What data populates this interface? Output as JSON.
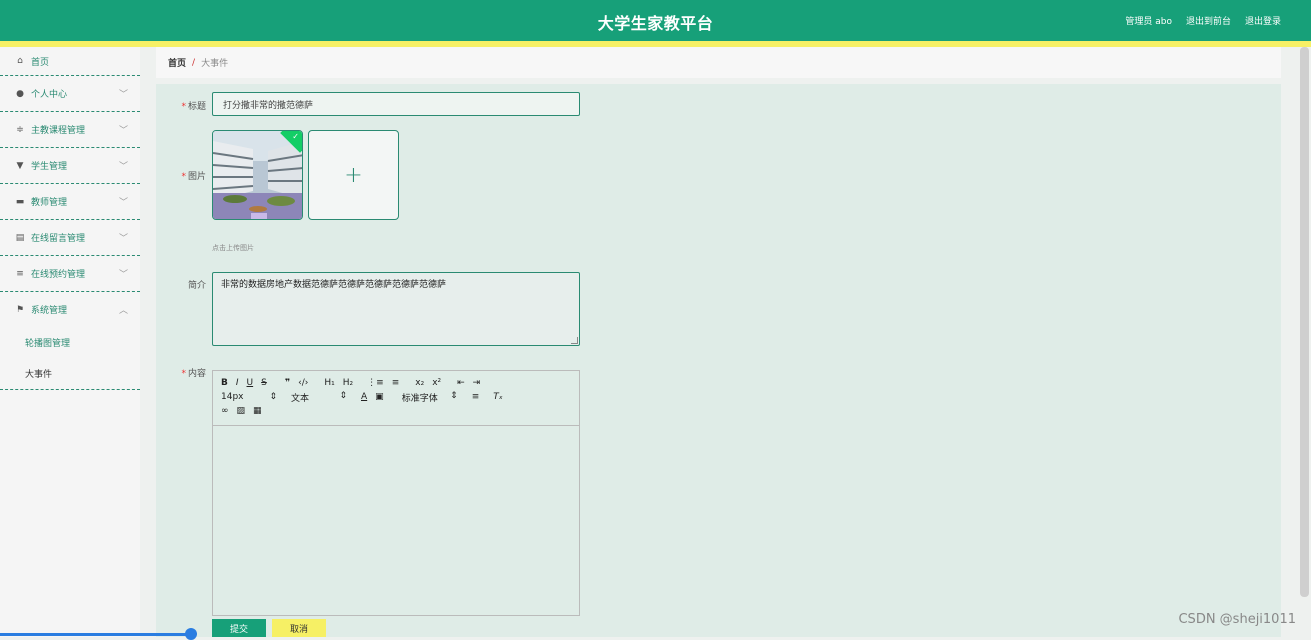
{
  "header": {
    "title": "大学生家教平台",
    "admin": "管理员 abo",
    "to_front": "退出到前台",
    "logout": "退出登录"
  },
  "sidebar": {
    "items": [
      {
        "label": "首页",
        "icon": "home-icon",
        "glyph": "⌂"
      },
      {
        "label": "个人中心",
        "icon": "user-icon",
        "glyph": "●"
      },
      {
        "label": "主教课程管理",
        "icon": "sliders-icon",
        "glyph": "≑"
      },
      {
        "label": "学生管理",
        "icon": "student-icon",
        "glyph": "▼"
      },
      {
        "label": "教师管理",
        "icon": "teacher-icon",
        "glyph": "▬"
      },
      {
        "label": "在线留言管理",
        "icon": "clipboard-icon",
        "glyph": "▤"
      },
      {
        "label": "在线预约管理",
        "icon": "list-icon",
        "glyph": "≡"
      },
      {
        "label": "系统管理",
        "icon": "flag-icon",
        "glyph": "⚑"
      }
    ],
    "sub_items": [
      {
        "label": "轮播图管理"
      },
      {
        "label": "大事件"
      }
    ]
  },
  "breadcrumb": {
    "home": "首页",
    "separator": "/",
    "current": "大事件"
  },
  "form": {
    "title_label": "标题",
    "title_value": "打分撒非常的撒范德萨",
    "image_label": "图片",
    "upload_hint": "点击上传图片",
    "intro_label": "简介",
    "intro_value": "非常的数据房地产数据范德萨范德萨范德萨范德萨范德萨",
    "content_label": "内容",
    "required_mark": "*",
    "submit": "提交",
    "cancel": "取消"
  },
  "editor": {
    "font_size": "14px",
    "text_style": "文本",
    "font_family": "标准字体"
  },
  "watermark": "CSDN @sheji1011",
  "colors": {
    "primary": "#17a079",
    "accent": "#f6f065"
  }
}
